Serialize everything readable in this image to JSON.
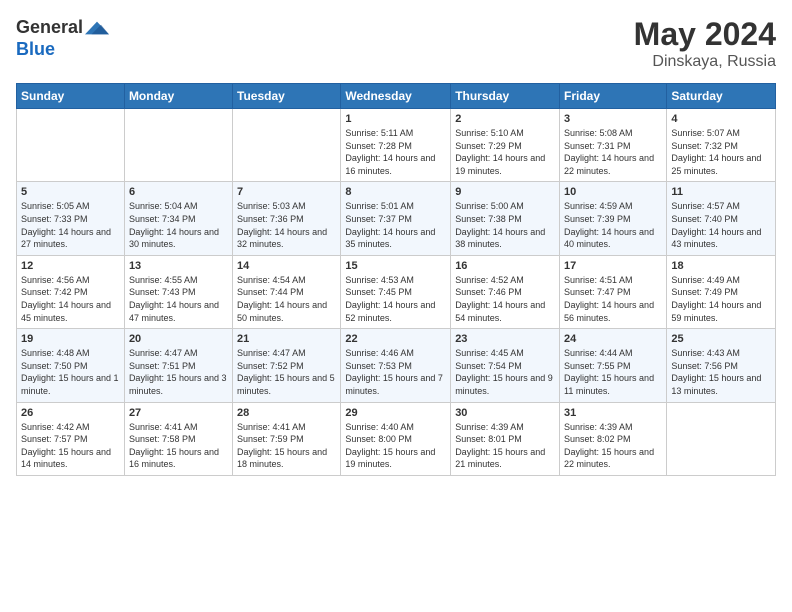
{
  "logo": {
    "general": "General",
    "blue": "Blue"
  },
  "header": {
    "month_year": "May 2024",
    "location": "Dinskaya, Russia"
  },
  "days_of_week": [
    "Sunday",
    "Monday",
    "Tuesday",
    "Wednesday",
    "Thursday",
    "Friday",
    "Saturday"
  ],
  "weeks": [
    [
      {
        "day": "",
        "info": ""
      },
      {
        "day": "",
        "info": ""
      },
      {
        "day": "",
        "info": ""
      },
      {
        "day": "1",
        "info": "Sunrise: 5:11 AM\nSunset: 7:28 PM\nDaylight: 14 hours and 16 minutes."
      },
      {
        "day": "2",
        "info": "Sunrise: 5:10 AM\nSunset: 7:29 PM\nDaylight: 14 hours and 19 minutes."
      },
      {
        "day": "3",
        "info": "Sunrise: 5:08 AM\nSunset: 7:31 PM\nDaylight: 14 hours and 22 minutes."
      },
      {
        "day": "4",
        "info": "Sunrise: 5:07 AM\nSunset: 7:32 PM\nDaylight: 14 hours and 25 minutes."
      }
    ],
    [
      {
        "day": "5",
        "info": "Sunrise: 5:05 AM\nSunset: 7:33 PM\nDaylight: 14 hours and 27 minutes."
      },
      {
        "day": "6",
        "info": "Sunrise: 5:04 AM\nSunset: 7:34 PM\nDaylight: 14 hours and 30 minutes."
      },
      {
        "day": "7",
        "info": "Sunrise: 5:03 AM\nSunset: 7:36 PM\nDaylight: 14 hours and 32 minutes."
      },
      {
        "day": "8",
        "info": "Sunrise: 5:01 AM\nSunset: 7:37 PM\nDaylight: 14 hours and 35 minutes."
      },
      {
        "day": "9",
        "info": "Sunrise: 5:00 AM\nSunset: 7:38 PM\nDaylight: 14 hours and 38 minutes."
      },
      {
        "day": "10",
        "info": "Sunrise: 4:59 AM\nSunset: 7:39 PM\nDaylight: 14 hours and 40 minutes."
      },
      {
        "day": "11",
        "info": "Sunrise: 4:57 AM\nSunset: 7:40 PM\nDaylight: 14 hours and 43 minutes."
      }
    ],
    [
      {
        "day": "12",
        "info": "Sunrise: 4:56 AM\nSunset: 7:42 PM\nDaylight: 14 hours and 45 minutes."
      },
      {
        "day": "13",
        "info": "Sunrise: 4:55 AM\nSunset: 7:43 PM\nDaylight: 14 hours and 47 minutes."
      },
      {
        "day": "14",
        "info": "Sunrise: 4:54 AM\nSunset: 7:44 PM\nDaylight: 14 hours and 50 minutes."
      },
      {
        "day": "15",
        "info": "Sunrise: 4:53 AM\nSunset: 7:45 PM\nDaylight: 14 hours and 52 minutes."
      },
      {
        "day": "16",
        "info": "Sunrise: 4:52 AM\nSunset: 7:46 PM\nDaylight: 14 hours and 54 minutes."
      },
      {
        "day": "17",
        "info": "Sunrise: 4:51 AM\nSunset: 7:47 PM\nDaylight: 14 hours and 56 minutes."
      },
      {
        "day": "18",
        "info": "Sunrise: 4:49 AM\nSunset: 7:49 PM\nDaylight: 14 hours and 59 minutes."
      }
    ],
    [
      {
        "day": "19",
        "info": "Sunrise: 4:48 AM\nSunset: 7:50 PM\nDaylight: 15 hours and 1 minute."
      },
      {
        "day": "20",
        "info": "Sunrise: 4:47 AM\nSunset: 7:51 PM\nDaylight: 15 hours and 3 minutes."
      },
      {
        "day": "21",
        "info": "Sunrise: 4:47 AM\nSunset: 7:52 PM\nDaylight: 15 hours and 5 minutes."
      },
      {
        "day": "22",
        "info": "Sunrise: 4:46 AM\nSunset: 7:53 PM\nDaylight: 15 hours and 7 minutes."
      },
      {
        "day": "23",
        "info": "Sunrise: 4:45 AM\nSunset: 7:54 PM\nDaylight: 15 hours and 9 minutes."
      },
      {
        "day": "24",
        "info": "Sunrise: 4:44 AM\nSunset: 7:55 PM\nDaylight: 15 hours and 11 minutes."
      },
      {
        "day": "25",
        "info": "Sunrise: 4:43 AM\nSunset: 7:56 PM\nDaylight: 15 hours and 13 minutes."
      }
    ],
    [
      {
        "day": "26",
        "info": "Sunrise: 4:42 AM\nSunset: 7:57 PM\nDaylight: 15 hours and 14 minutes."
      },
      {
        "day": "27",
        "info": "Sunrise: 4:41 AM\nSunset: 7:58 PM\nDaylight: 15 hours and 16 minutes."
      },
      {
        "day": "28",
        "info": "Sunrise: 4:41 AM\nSunset: 7:59 PM\nDaylight: 15 hours and 18 minutes."
      },
      {
        "day": "29",
        "info": "Sunrise: 4:40 AM\nSunset: 8:00 PM\nDaylight: 15 hours and 19 minutes."
      },
      {
        "day": "30",
        "info": "Sunrise: 4:39 AM\nSunset: 8:01 PM\nDaylight: 15 hours and 21 minutes."
      },
      {
        "day": "31",
        "info": "Sunrise: 4:39 AM\nSunset: 8:02 PM\nDaylight: 15 hours and 22 minutes."
      },
      {
        "day": "",
        "info": ""
      }
    ]
  ]
}
